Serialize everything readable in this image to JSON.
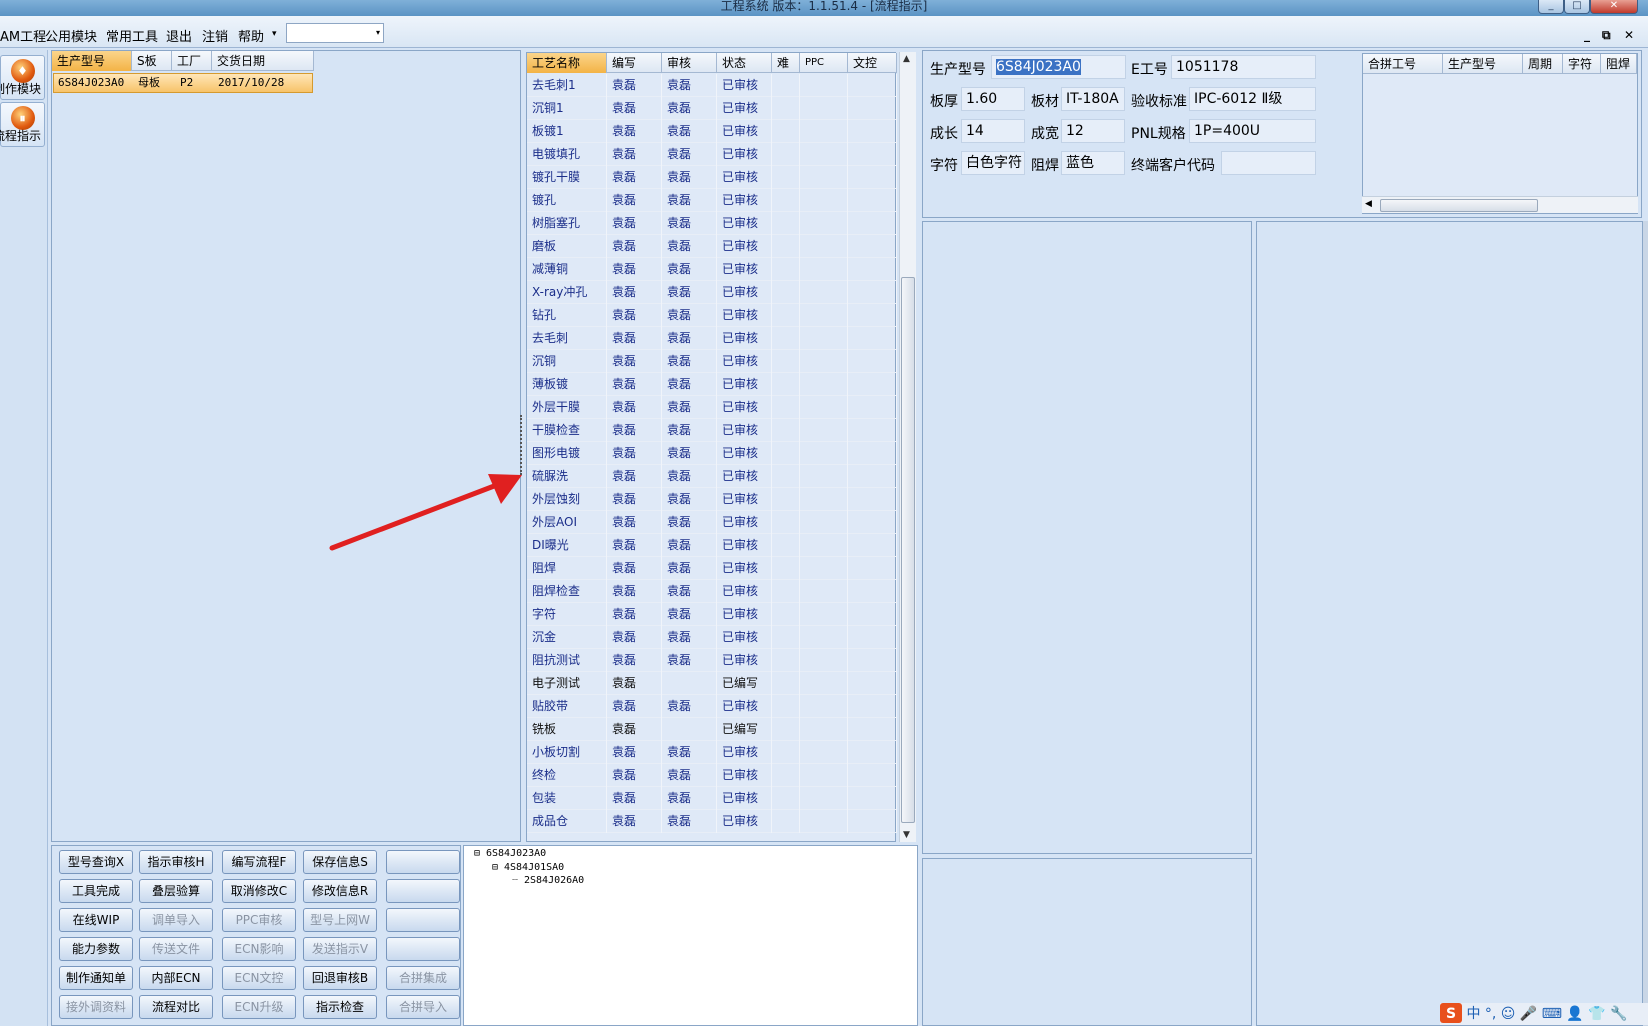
{
  "window": {
    "title": "工程系统   版本：1.1.51.4 - [流程指示]",
    "controls": [
      "_",
      "□",
      "✕"
    ]
  },
  "menubar": {
    "items": [
      "AM工程",
      "公用模块",
      "常用工具",
      "退出",
      "注销",
      "帮助"
    ],
    "help_dropdown": "▾",
    "combo_value": "",
    "combo_arrow": "▾",
    "mdi_controls": [
      "_",
      "⧉",
      "✕"
    ]
  },
  "leftbar": {
    "buttons": [
      {
        "label": "制作模块",
        "icon": "flame-icon",
        "glyph": "♦"
      },
      {
        "label": "流程指示",
        "icon": "pause-icon",
        "glyph": "⏸"
      }
    ]
  },
  "orders": {
    "columns": [
      "生产型号",
      "S板",
      "工厂",
      "交货日期"
    ],
    "rows": [
      {
        "model": "6S84J023A0",
        "board": "母板",
        "factory": "P2",
        "date": "2017/10/28"
      }
    ]
  },
  "process": {
    "columns": [
      "工艺名称",
      "编写",
      "审核",
      "状态",
      "难",
      "PPC",
      "文控"
    ],
    "rows": [
      {
        "name": "去毛刺1",
        "writer": "袁磊",
        "reviewer": "袁磊",
        "status": "已审核"
      },
      {
        "name": "沉铜1",
        "writer": "袁磊",
        "reviewer": "袁磊",
        "status": "已审核"
      },
      {
        "name": "板镀1",
        "writer": "袁磊",
        "reviewer": "袁磊",
        "status": "已审核"
      },
      {
        "name": "电镀填孔",
        "writer": "袁磊",
        "reviewer": "袁磊",
        "status": "已审核"
      },
      {
        "name": "镀孔干膜",
        "writer": "袁磊",
        "reviewer": "袁磊",
        "status": "已审核"
      },
      {
        "name": "镀孔",
        "writer": "袁磊",
        "reviewer": "袁磊",
        "status": "已审核"
      },
      {
        "name": "树脂塞孔",
        "writer": "袁磊",
        "reviewer": "袁磊",
        "status": "已审核"
      },
      {
        "name": "磨板",
        "writer": "袁磊",
        "reviewer": "袁磊",
        "status": "已审核"
      },
      {
        "name": "减薄铜",
        "writer": "袁磊",
        "reviewer": "袁磊",
        "status": "已审核"
      },
      {
        "name": "X-ray冲孔",
        "writer": "袁磊",
        "reviewer": "袁磊",
        "status": "已审核"
      },
      {
        "name": "钻孔",
        "writer": "袁磊",
        "reviewer": "袁磊",
        "status": "已审核"
      },
      {
        "name": "去毛刺",
        "writer": "袁磊",
        "reviewer": "袁磊",
        "status": "已审核"
      },
      {
        "name": "沉铜",
        "writer": "袁磊",
        "reviewer": "袁磊",
        "status": "已审核"
      },
      {
        "name": "薄板镀",
        "writer": "袁磊",
        "reviewer": "袁磊",
        "status": "已审核"
      },
      {
        "name": "外层干膜",
        "writer": "袁磊",
        "reviewer": "袁磊",
        "status": "已审核"
      },
      {
        "name": "干膜检查",
        "writer": "袁磊",
        "reviewer": "袁磊",
        "status": "已审核"
      },
      {
        "name": "图形电镀",
        "writer": "袁磊",
        "reviewer": "袁磊",
        "status": "已审核"
      },
      {
        "name": "硫脲洗",
        "writer": "袁磊",
        "reviewer": "袁磊",
        "status": "已审核"
      },
      {
        "name": "外层蚀刻",
        "writer": "袁磊",
        "reviewer": "袁磊",
        "status": "已审核"
      },
      {
        "name": "外层AOI",
        "writer": "袁磊",
        "reviewer": "袁磊",
        "status": "已审核"
      },
      {
        "name": "DI曝光",
        "writer": "袁磊",
        "reviewer": "袁磊",
        "status": "已审核"
      },
      {
        "name": "阻焊",
        "writer": "袁磊",
        "reviewer": "袁磊",
        "status": "已审核"
      },
      {
        "name": "阻焊检查",
        "writer": "袁磊",
        "reviewer": "袁磊",
        "status": "已审核"
      },
      {
        "name": "字符",
        "writer": "袁磊",
        "reviewer": "袁磊",
        "status": "已审核"
      },
      {
        "name": "沉金",
        "writer": "袁磊",
        "reviewer": "袁磊",
        "status": "已审核"
      },
      {
        "name": "阻抗测试",
        "writer": "袁磊",
        "reviewer": "袁磊",
        "status": "已审核"
      },
      {
        "name": "电子测试",
        "writer": "袁磊",
        "reviewer": "",
        "status": "已编写",
        "dim": true
      },
      {
        "name": "贴胶带",
        "writer": "袁磊",
        "reviewer": "袁磊",
        "status": "已审核"
      },
      {
        "name": "铣板",
        "writer": "袁磊",
        "reviewer": "",
        "status": "已编写",
        "dim": true
      },
      {
        "name": "小板切割",
        "writer": "袁磊",
        "reviewer": "袁磊",
        "status": "已审核"
      },
      {
        "name": "终检",
        "writer": "袁磊",
        "reviewer": "袁磊",
        "status": "已审核"
      },
      {
        "name": "包装",
        "writer": "袁磊",
        "reviewer": "袁磊",
        "status": "已审核"
      },
      {
        "name": "成品仓",
        "writer": "袁磊",
        "reviewer": "袁磊",
        "status": "已审核"
      }
    ]
  },
  "actions": [
    [
      {
        "label": "型号查询X",
        "enabled": true
      },
      {
        "label": "指示审核H",
        "enabled": true
      },
      {
        "label": "编写流程F",
        "enabled": true
      },
      {
        "label": "保存信息S",
        "enabled": true
      },
      {
        "label": "",
        "enabled": true
      }
    ],
    [
      {
        "label": "工具完成",
        "enabled": true
      },
      {
        "label": "叠层验算",
        "enabled": true
      },
      {
        "label": "取消修改C",
        "enabled": true
      },
      {
        "label": "修改信息R",
        "enabled": true
      },
      {
        "label": "",
        "enabled": true
      }
    ],
    [
      {
        "label": "在线WIP",
        "enabled": true
      },
      {
        "label": "调单导入",
        "enabled": false
      },
      {
        "label": "PPC审核",
        "enabled": false
      },
      {
        "label": "型号上网W",
        "enabled": false
      },
      {
        "label": "",
        "enabled": true
      }
    ],
    [
      {
        "label": "能力参数",
        "enabled": true
      },
      {
        "label": "传送文件",
        "enabled": false
      },
      {
        "label": "ECN影响",
        "enabled": false
      },
      {
        "label": "发送指示V",
        "enabled": false
      },
      {
        "label": "",
        "enabled": true
      }
    ],
    [
      {
        "label": "制作通知单",
        "enabled": true
      },
      {
        "label": "内部ECN",
        "enabled": true
      },
      {
        "label": "ECN文控",
        "enabled": false
      },
      {
        "label": "回退审核B",
        "enabled": true
      },
      {
        "label": "合拼集成",
        "enabled": false
      }
    ],
    [
      {
        "label": "接外调资料",
        "enabled": false
      },
      {
        "label": "流程对比",
        "enabled": true
      },
      {
        "label": "ECN升级",
        "enabled": false
      },
      {
        "label": "指示检查",
        "enabled": true
      },
      {
        "label": "合拼导入",
        "enabled": false
      }
    ]
  ],
  "tree": {
    "nodes": [
      "6S84J023A0",
      "4S84J01SA0",
      "2S84J026A0"
    ]
  },
  "info": {
    "model_label": "生产型号",
    "model_value": "6S84J023A0",
    "eno_label": "E工号",
    "eno_value": "1051178",
    "thickness_label": "板厚",
    "thickness_value": "1.60",
    "material_label": "板材",
    "material_value": "IT-180A",
    "standard_label": "验收标准",
    "standard_value": "IPC-6012 Ⅱ级",
    "length_label": "成长",
    "length_value": "14",
    "width_label": "成宽",
    "width_value": "12",
    "pnl_label": "PNL规格",
    "pnl_value": "1P=400U",
    "char_label": "字符",
    "char_value": "白色字符",
    "mask_label": "阻焊",
    "mask_value": "蓝色",
    "customer_label": "终端客户代码",
    "customer_value": ""
  },
  "merge": {
    "columns": [
      "合拼工号",
      "生产型号",
      "周期",
      "字符",
      "阻焊"
    ]
  },
  "ime": {
    "logo": "S",
    "text": "中 °, ☺ 🎤 ⌨ 👤 👕 🔧"
  },
  "colors": {
    "accent": "#f3b346",
    "panel": "#d6e4f5",
    "text_link": "#1b2e8a",
    "annotation_arrow": "#e02020"
  }
}
